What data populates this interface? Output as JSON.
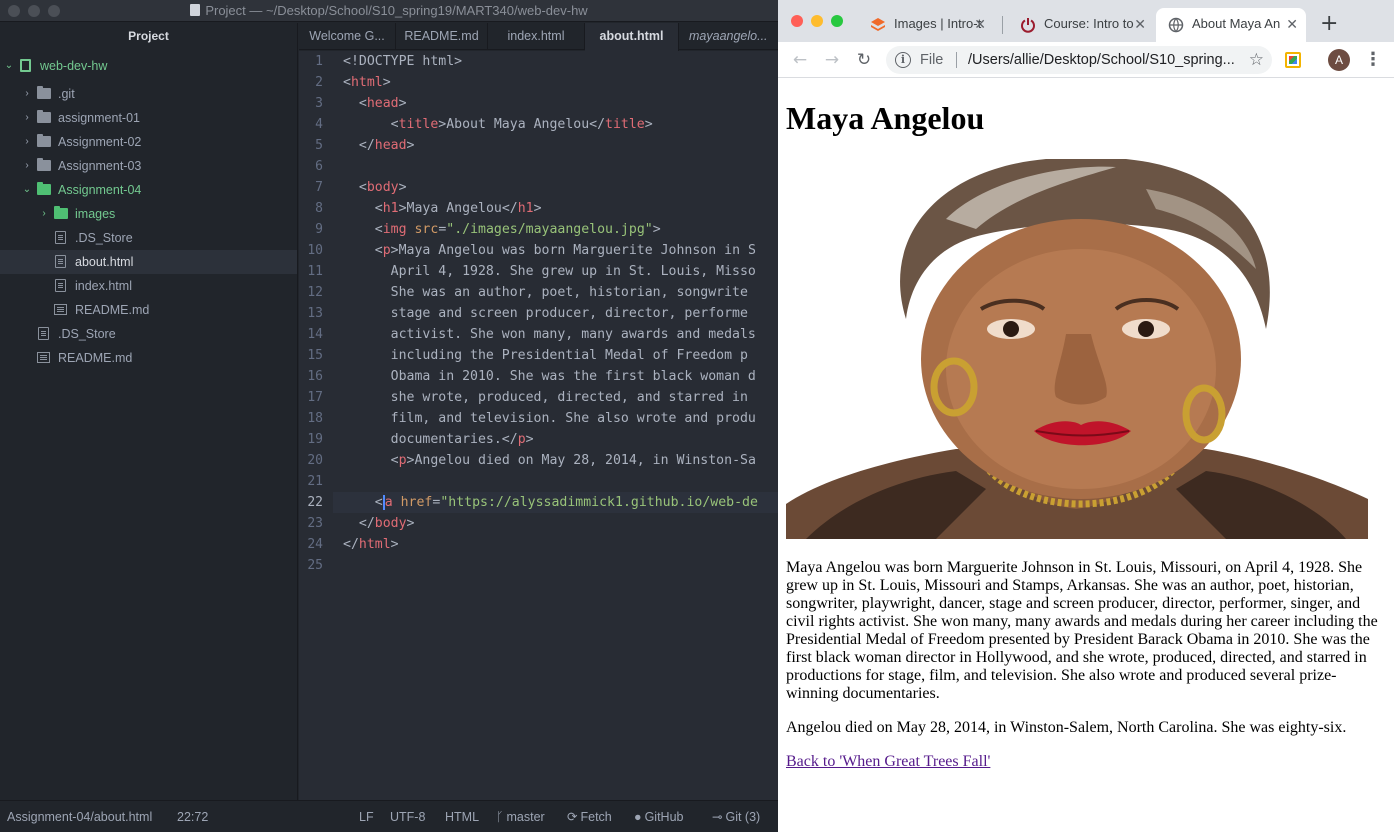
{
  "atom": {
    "window_title": "Project — ~/Desktop/School/S10_spring19/MART340/web-dev-hw",
    "tree": {
      "header": "Project",
      "items": [
        {
          "label": "web-dev-hw",
          "kind": "repo",
          "expanded": true
        },
        {
          "label": ".git",
          "kind": "folder",
          "expanded": false
        },
        {
          "label": "assignment-01",
          "kind": "folder",
          "expanded": false
        },
        {
          "label": "Assignment-02",
          "kind": "folder",
          "expanded": false
        },
        {
          "label": "Assignment-03",
          "kind": "folder",
          "expanded": false
        },
        {
          "label": "Assignment-04",
          "kind": "folder",
          "expanded": true
        },
        {
          "label": "images",
          "kind": "folder",
          "expanded": false
        },
        {
          "label": ".DS_Store",
          "kind": "file"
        },
        {
          "label": "about.html",
          "kind": "file",
          "selected": true
        },
        {
          "label": "index.html",
          "kind": "file"
        },
        {
          "label": "README.md",
          "kind": "markdown"
        },
        {
          "label": ".DS_Store",
          "kind": "file"
        },
        {
          "label": "README.md",
          "kind": "markdown"
        }
      ]
    },
    "tabs": [
      {
        "label": "Welcome G..."
      },
      {
        "label": "README.md"
      },
      {
        "label": "index.html"
      },
      {
        "label": "about.html",
        "active": true
      },
      {
        "label": "mayaangelo...",
        "preview": true
      }
    ],
    "line_numbers": [
      "1",
      "2",
      "3",
      "4",
      "5",
      "6",
      "7",
      "8",
      "9",
      "10",
      "11",
      "12",
      "13",
      "14",
      "15",
      "16",
      "17",
      "18",
      "19",
      "20",
      "21",
      "22",
      "23",
      "24",
      "25"
    ],
    "code": {
      "l1": "<!DOCTYPE html>",
      "l4_text": "About Maya Angelou",
      "l8_text": "Maya Angelou",
      "l9_src": "\"./images/mayaangelou.jpg\"",
      "l10_text": "Maya Angelou was born Marguerite Johnson in S",
      "l11": "April 4, 1928. She grew up in St. Louis, Misso",
      "l12": "She was an author, poet, historian, songwrite",
      "l13": "stage and screen producer, director, performe",
      "l14": "activist. She won many, many awards and medals",
      "l15": "including the Presidential Medal of Freedom p",
      "l16": "Obama in 2010. She was the first black woman d",
      "l17": "she wrote, produced, directed, and starred in",
      "l18": "film, and television. She also wrote and produ",
      "l19_text": "documentaries.",
      "l20_text": "Angelou died on May 28, 2014, in Winston-Sa",
      "l22_href": "\"https://alyssadimmick1.github.io/web-de"
    },
    "status": {
      "path": "Assignment-04/about.html",
      "cursor": "22:72",
      "line_ending": "LF",
      "encoding": "UTF-8",
      "grammar": "HTML",
      "branch": "master",
      "fetch": "Fetch",
      "github": "GitHub",
      "git": "Git (3)"
    }
  },
  "chrome": {
    "tabs": [
      {
        "title": "Images | Intro-t",
        "favicon": "stack-icon"
      },
      {
        "title": "Course: Intro to",
        "favicon": "power-icon"
      },
      {
        "title": "About Maya An",
        "favicon": "globe-icon",
        "active": true
      }
    ],
    "omnibox": {
      "scheme": "File",
      "url": "/Users/allie/Desktop/School/S10_spring..."
    },
    "avatar_letter": "A"
  },
  "page": {
    "heading": "Maya Angelou",
    "bio": "Maya Angelou was born Marguerite Johnson in St. Louis, Missouri, on April 4, 1928. She grew up in St. Louis, Missouri and Stamps, Arkansas. She was an author, poet, historian, songwriter, playwright, dancer, stage and screen producer, director, performer, singer, and civil rights activist. She won many, many awards and medals during her career including the Presidential Medal of Freedom presented by President Barack Obama in 2010. She was the first black woman director in Hollywood, and she wrote, produced, directed, and starred in productions for stage, film, and television. She also wrote and produced several prize-winning documentaries.",
    "died": "Angelou died on May 28, 2014, in Winston-Salem, North Carolina. She was eighty-six.",
    "back_link": "Back to 'When Great Trees Fall'"
  },
  "colors": {
    "atom_bg": "#21252b",
    "editor_bg": "#282c34",
    "tag": "#e06c75",
    "attr": "#d19a66",
    "string": "#98c379",
    "git_green": "#73c990",
    "visited_link": "#551a8b"
  }
}
